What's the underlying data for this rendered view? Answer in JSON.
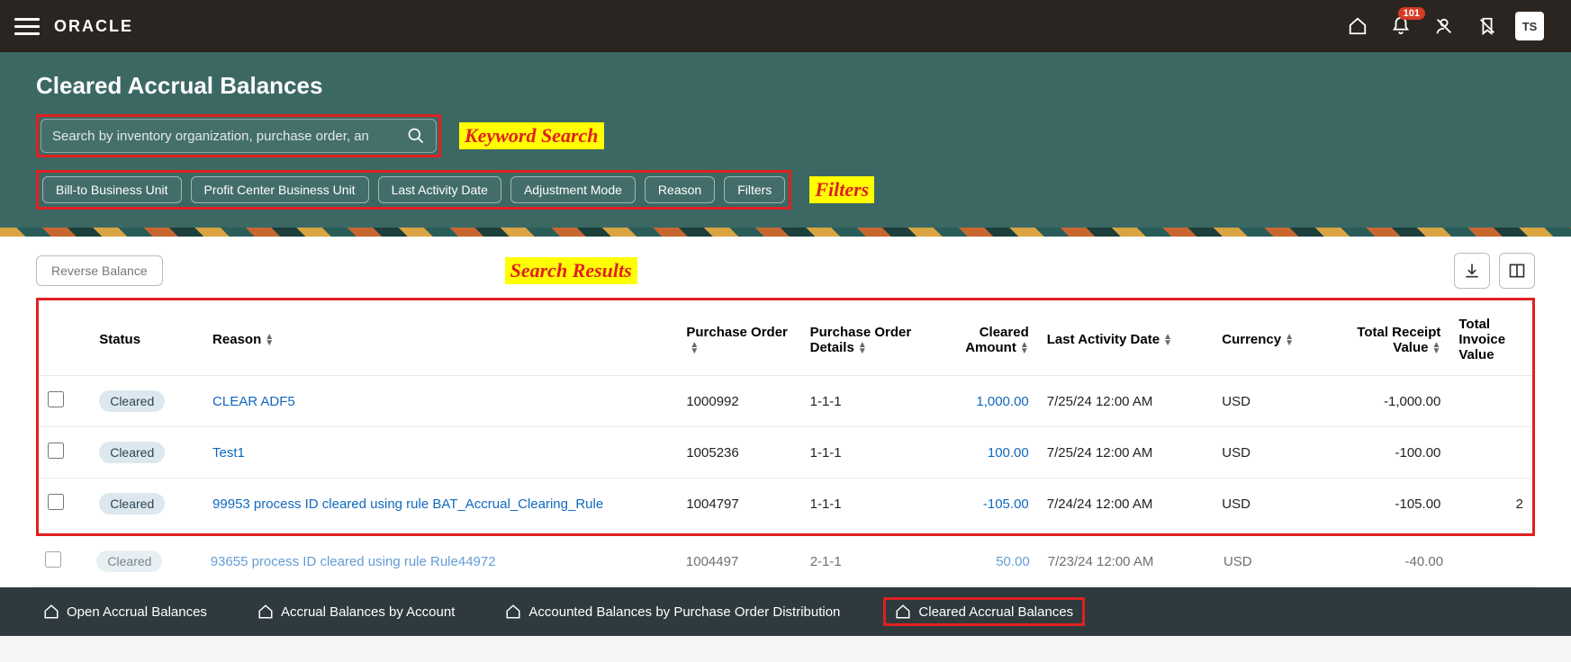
{
  "topbar": {
    "brand": "ORACLE",
    "badge": "101",
    "avatar": "TS"
  },
  "hero": {
    "title": "Cleared Accrual Balances",
    "search_placeholder": "Search by inventory organization, purchase order, an",
    "annot_search": "Keyword Search",
    "annot_filters": "Filters",
    "chips": [
      "Bill-to Business Unit",
      "Profit Center Business Unit",
      "Last Activity Date",
      "Adjustment Mode",
      "Reason",
      "Filters"
    ]
  },
  "actions": {
    "reverse": "Reverse Balance",
    "annot_results": "Search Results"
  },
  "columns": {
    "status": "Status",
    "reason": "Reason",
    "po": "Purchase Order",
    "pod": "Purchase Order Details",
    "cleared": "Cleared Amount",
    "last": "Last Activity Date",
    "currency": "Currency",
    "receipt": "Total Receipt Value",
    "invoice": "Total Invoice Value"
  },
  "rows": [
    {
      "status": "Cleared",
      "reason": "CLEAR ADF5",
      "po": "1000992",
      "pod": "1-1-1",
      "cleared": "1,000.00",
      "last": "7/25/24 12:00 AM",
      "currency": "USD",
      "receipt": "-1,000.00",
      "invoice": ""
    },
    {
      "status": "Cleared",
      "reason": "Test1",
      "po": "1005236",
      "pod": "1-1-1",
      "cleared": "100.00",
      "last": "7/25/24 12:00 AM",
      "currency": "USD",
      "receipt": "-100.00",
      "invoice": ""
    },
    {
      "status": "Cleared",
      "reason": "99953 process ID cleared using rule BAT_Accrual_Clearing_Rule",
      "po": "1004797",
      "pod": "1-1-1",
      "cleared": "-105.00",
      "last": "7/24/24 12:00 AM",
      "currency": "USD",
      "receipt": "-105.00",
      "invoice": "2"
    },
    {
      "status": "Cleared",
      "reason": "93655 process ID cleared using rule Rule44972",
      "po": "1004497",
      "pod": "2-1-1",
      "cleared": "50.00",
      "last": "7/23/24 12:00 AM",
      "currency": "USD",
      "receipt": "-40.00",
      "invoice": ""
    }
  ],
  "bottom": {
    "items": [
      "Open Accrual Balances",
      "Accrual Balances by Account",
      "Accounted Balances by Purchase Order Distribution",
      "Cleared Accrual Balances"
    ]
  }
}
